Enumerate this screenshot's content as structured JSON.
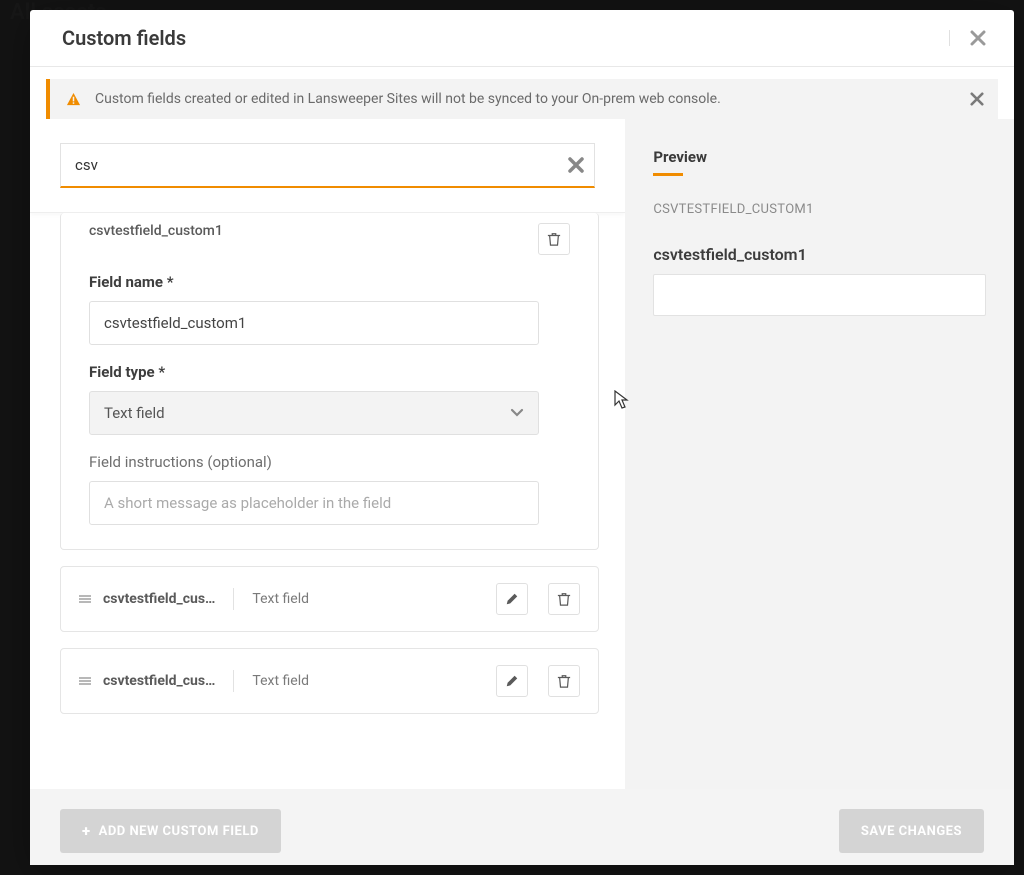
{
  "background": {
    "title": "All assets"
  },
  "modal": {
    "title": "Custom fields",
    "alert": "Custom fields created or edited in Lansweeper Sites will not be synced to your On-prem web console.",
    "search": {
      "value": "csv"
    },
    "open_field": {
      "heading": "csvtestfield_custom1",
      "name_label": "Field name *",
      "name_value": "csvtestfield_custom1",
      "type_label": "Field type *",
      "type_value": "Text field",
      "instructions_label": "Field instructions (optional)",
      "instructions_placeholder": "A short message as placeholder in the field"
    },
    "fields": [
      {
        "name": "csvtestfield_cus…",
        "type": "Text field"
      },
      {
        "name": "csvtestfield_cus…",
        "type": "Text field"
      }
    ],
    "footer": {
      "add_label": "ADD NEW CUSTOM FIELD",
      "save_label": "SAVE CHANGES"
    }
  },
  "preview": {
    "title": "Preview",
    "upper": "CSVTESTFIELD_CUSTOM1",
    "name": "csvtestfield_custom1"
  }
}
